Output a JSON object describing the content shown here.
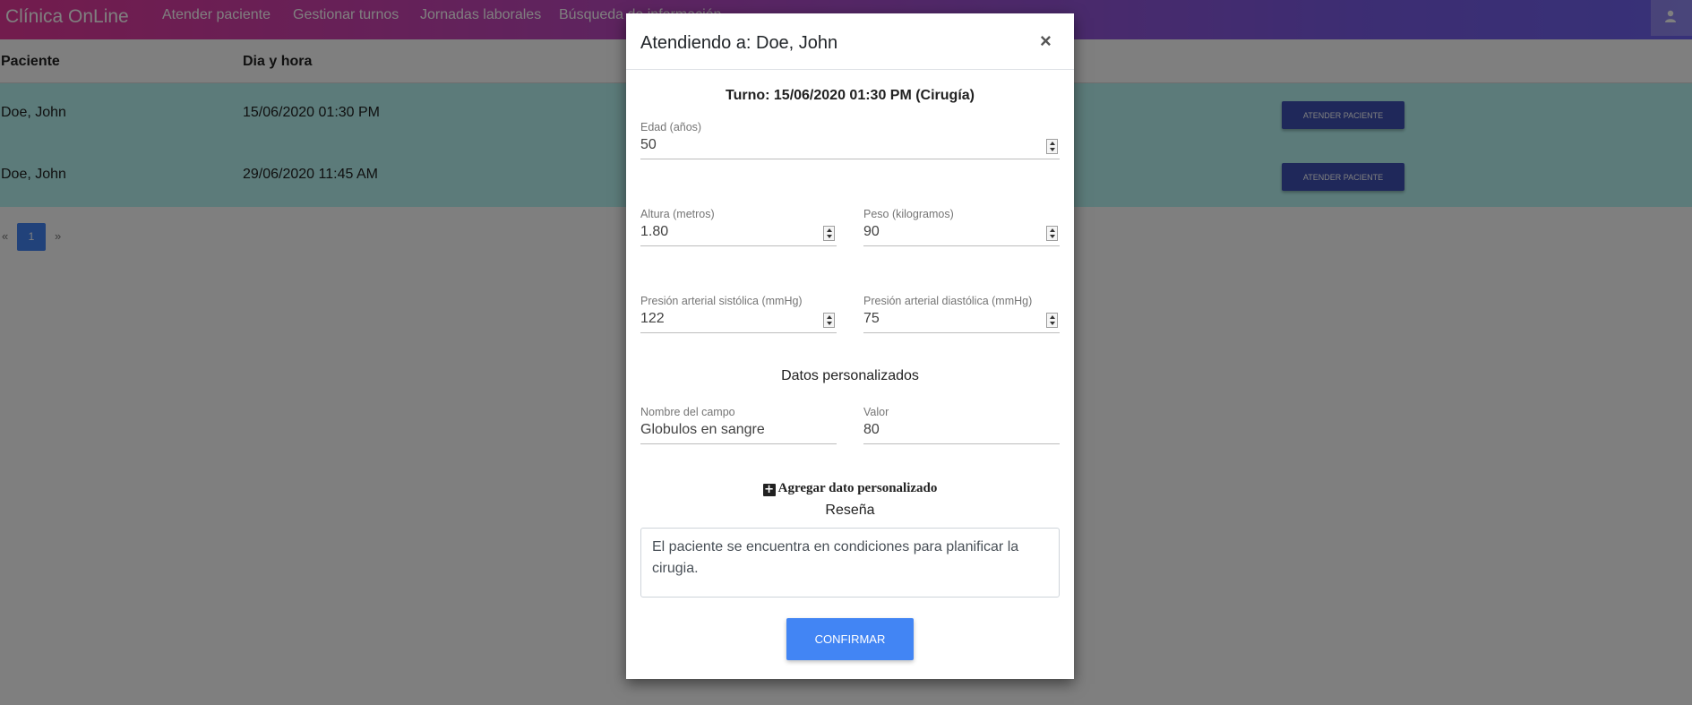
{
  "navbar": {
    "brand": "Clínica OnLine",
    "links": [
      "Atender paciente",
      "Gestionar turnos",
      "Jornadas laborales",
      "Búsqueda de información"
    ],
    "user_icon": "user-icon"
  },
  "table": {
    "headers": [
      "Paciente",
      "Dia y hora"
    ],
    "rows": [
      {
        "paciente": "Doe, John",
        "fecha": "15/06/2020 01:30 PM",
        "action": "Atender paciente"
      },
      {
        "paciente": "Doe, John",
        "fecha": "29/06/2020 11:45 AM",
        "action": "Atender paciente"
      }
    ],
    "row_color": "#b8f7f5"
  },
  "pagination": {
    "prev": "«",
    "page": "1",
    "next": "»"
  },
  "modal": {
    "title": "Atendiendo a: Doe, John",
    "close": "×",
    "turno": "Turno: 15/06/2020 01:30 PM (Cirugía)",
    "fields": {
      "edad": {
        "label": "Edad (años)",
        "value": "50"
      },
      "altura": {
        "label": "Altura (metros)",
        "value": "1.80"
      },
      "peso": {
        "label": "Peso (kilogramos)",
        "value": "90"
      },
      "sistolica": {
        "label": "Presión arterial sistólica (mmHg)",
        "value": "122"
      },
      "diastolica": {
        "label": "Presión arterial diastólica (mmHg)",
        "value": "75"
      }
    },
    "custom_section_title": "Datos personalizados",
    "custom_field": {
      "name_label": "Nombre del campo",
      "name_value": "Globulos en sangre",
      "value_label": "Valor",
      "value_value": "80"
    },
    "add_custom": "Agregar dato personalizado",
    "resena_label": "Reseña",
    "resena_text": "El paciente se encuentra en condiciones para planificar la cirugia.",
    "confirm": "Confirmar"
  },
  "colors": {
    "nav_gradient_start": "#e5389a",
    "nav_gradient_end": "#6e63f0",
    "primary_button": "#4285f4",
    "indigo_button": "#3f51b5"
  }
}
